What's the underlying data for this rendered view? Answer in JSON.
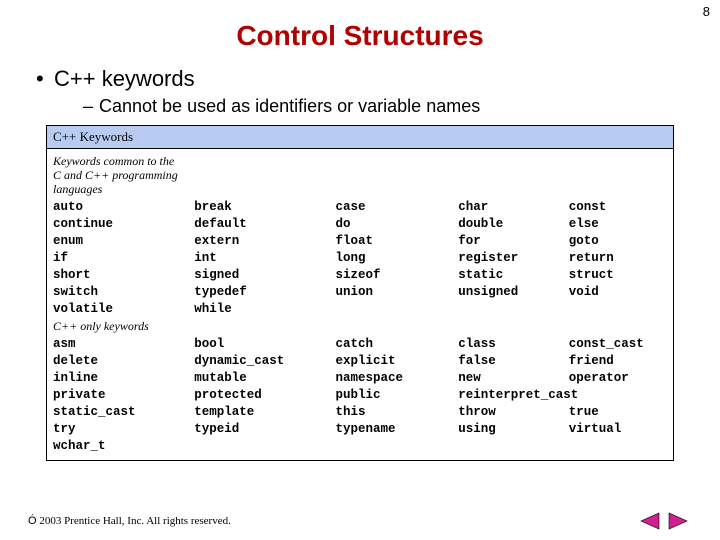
{
  "page_number": "8",
  "title": "Control Structures",
  "bullet1": "C++ keywords",
  "bullet2": "Cannot be used as identifiers or variable names",
  "table_header": "C++ Keywords",
  "section_common_line1": "Keywords common to the",
  "section_common_line2": "C and C++ programming",
  "section_common_line3": "languages",
  "section_cpp_only": "C++ only keywords",
  "common_keywords": {
    "r0": [
      "auto",
      "break",
      "case",
      "char",
      "const"
    ],
    "r1": [
      "continue",
      "default",
      "do",
      "double",
      "else"
    ],
    "r2": [
      "enum",
      "extern",
      "float",
      "for",
      "goto"
    ],
    "r3": [
      "if",
      "int",
      "long",
      "register",
      "return"
    ],
    "r4": [
      "short",
      "signed",
      "sizeof",
      "static",
      "struct"
    ],
    "r5": [
      "switch",
      "typedef",
      "union",
      "unsigned",
      "void"
    ],
    "r6": [
      "volatile",
      "while",
      "",
      "",
      ""
    ]
  },
  "cpp_only_keywords": {
    "r0": [
      "asm",
      "bool",
      "catch",
      "class",
      "const_cast"
    ],
    "r1": [
      "delete",
      "dynamic_cast",
      "explicit",
      "false",
      "friend"
    ],
    "r2": [
      "inline",
      "mutable",
      "namespace",
      "new",
      "operator"
    ],
    "r3": [
      "private",
      "protected",
      "public",
      "reinterpret_cast",
      ""
    ],
    "r4": [
      "static_cast",
      "template",
      "this",
      "throw",
      "true"
    ],
    "r5": [
      "try",
      "typeid",
      "typename",
      "using",
      "virtual"
    ],
    "r6": [
      "wchar_t",
      "",
      "",
      "",
      ""
    ]
  },
  "copyright": "2003 Prentice Hall, Inc.  All rights reserved.",
  "copyright_symbol": "Ó"
}
